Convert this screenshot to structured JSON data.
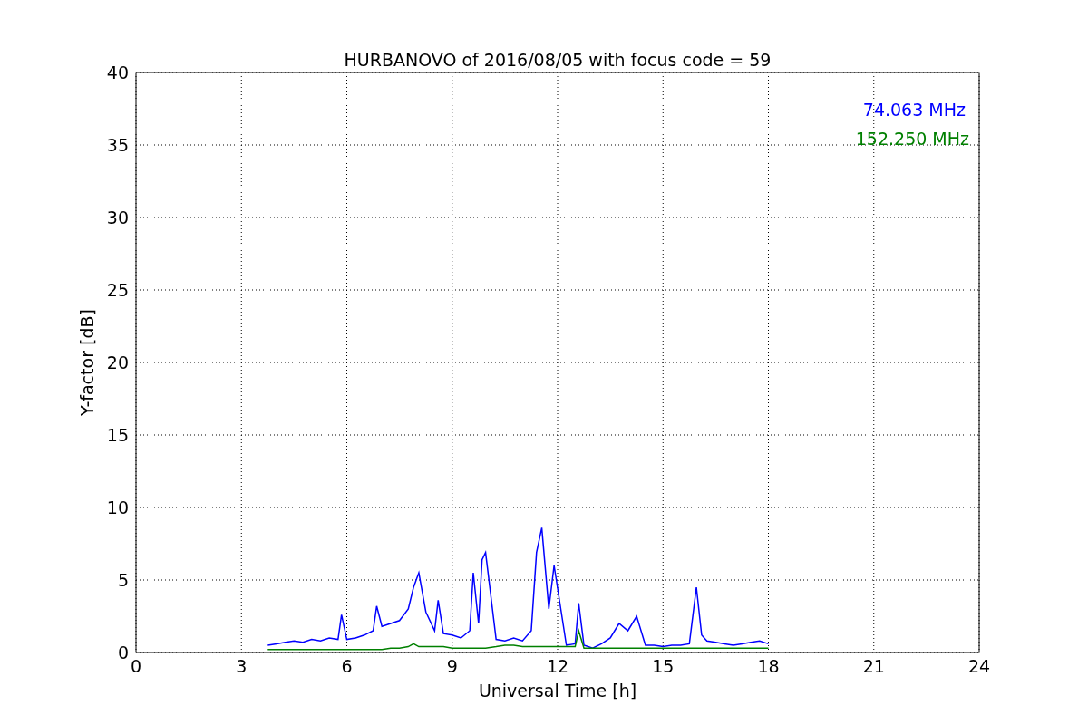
{
  "chart_data": {
    "type": "line",
    "grid": true,
    "title": "HURBANOVO of 2016/08/05 with focus code = 59",
    "xlabel": "Universal Time [h]",
    "ylabel": "Y-factor [dB]",
    "xlim": [
      0,
      24
    ],
    "ylim": [
      0,
      40
    ],
    "xticks": [
      0,
      3,
      6,
      9,
      12,
      15,
      18,
      21,
      24
    ],
    "yticks": [
      0,
      5,
      10,
      15,
      20,
      25,
      30,
      35,
      40
    ],
    "x": [
      3.75,
      4,
      4.25,
      4.5,
      4.75,
      5,
      5.25,
      5.5,
      5.75,
      5.85,
      6,
      6.25,
      6.5,
      6.75,
      6.85,
      7,
      7.25,
      7.5,
      7.75,
      7.9,
      8.05,
      8.25,
      8.5,
      8.6,
      8.75,
      9,
      9.25,
      9.5,
      9.6,
      9.75,
      9.85,
      9.95,
      10.25,
      10.5,
      10.75,
      11,
      11.25,
      11.4,
      11.55,
      11.75,
      11.9,
      12.25,
      12.5,
      12.6,
      12.75,
      13,
      13.25,
      13.5,
      13.75,
      14,
      14.25,
      14.5,
      14.75,
      15,
      15.25,
      15.5,
      15.75,
      15.95,
      16.1,
      16.25,
      16.5,
      16.75,
      17,
      17.25,
      17.5,
      17.75,
      18
    ],
    "series": [
      {
        "name": "74.063 MHz",
        "color": "#0000ff",
        "values": [
          0.5,
          0.6,
          0.7,
          0.8,
          0.7,
          0.9,
          0.8,
          1.0,
          0.9,
          2.6,
          0.9,
          1.0,
          1.2,
          1.5,
          3.2,
          1.8,
          2.0,
          2.2,
          3.0,
          4.5,
          5.5,
          2.8,
          1.5,
          3.6,
          1.3,
          1.2,
          1.0,
          1.5,
          5.5,
          2.0,
          6.4,
          6.9,
          0.9,
          0.8,
          1.0,
          0.8,
          1.5,
          6.9,
          8.6,
          3.0,
          6.0,
          0.5,
          0.6,
          3.4,
          0.5,
          0.3,
          0.6,
          1.0,
          2.0,
          1.5,
          2.5,
          0.5,
          0.5,
          0.4,
          0.5,
          0.5,
          0.6,
          4.5,
          1.2,
          0.8,
          0.7,
          0.6,
          0.5,
          0.6,
          0.7,
          0.8,
          0.6
        ]
      },
      {
        "name": "152.250 MHz",
        "color": "#008000",
        "values": [
          0.2,
          0.2,
          0.2,
          0.2,
          0.2,
          0.2,
          0.2,
          0.2,
          0.2,
          0.2,
          0.2,
          0.2,
          0.2,
          0.2,
          0.2,
          0.2,
          0.3,
          0.3,
          0.4,
          0.6,
          0.4,
          0.4,
          0.4,
          0.4,
          0.4,
          0.3,
          0.3,
          0.3,
          0.3,
          0.3,
          0.3,
          0.3,
          0.4,
          0.5,
          0.5,
          0.4,
          0.4,
          0.4,
          0.4,
          0.4,
          0.4,
          0.4,
          0.4,
          1.5,
          0.3,
          0.3,
          0.3,
          0.3,
          0.3,
          0.3,
          0.3,
          0.3,
          0.3,
          0.3,
          0.3,
          0.3,
          0.3,
          0.3,
          0.3,
          0.3,
          0.3,
          0.3,
          0.3,
          0.3,
          0.3,
          0.3,
          0.3
        ]
      }
    ]
  }
}
